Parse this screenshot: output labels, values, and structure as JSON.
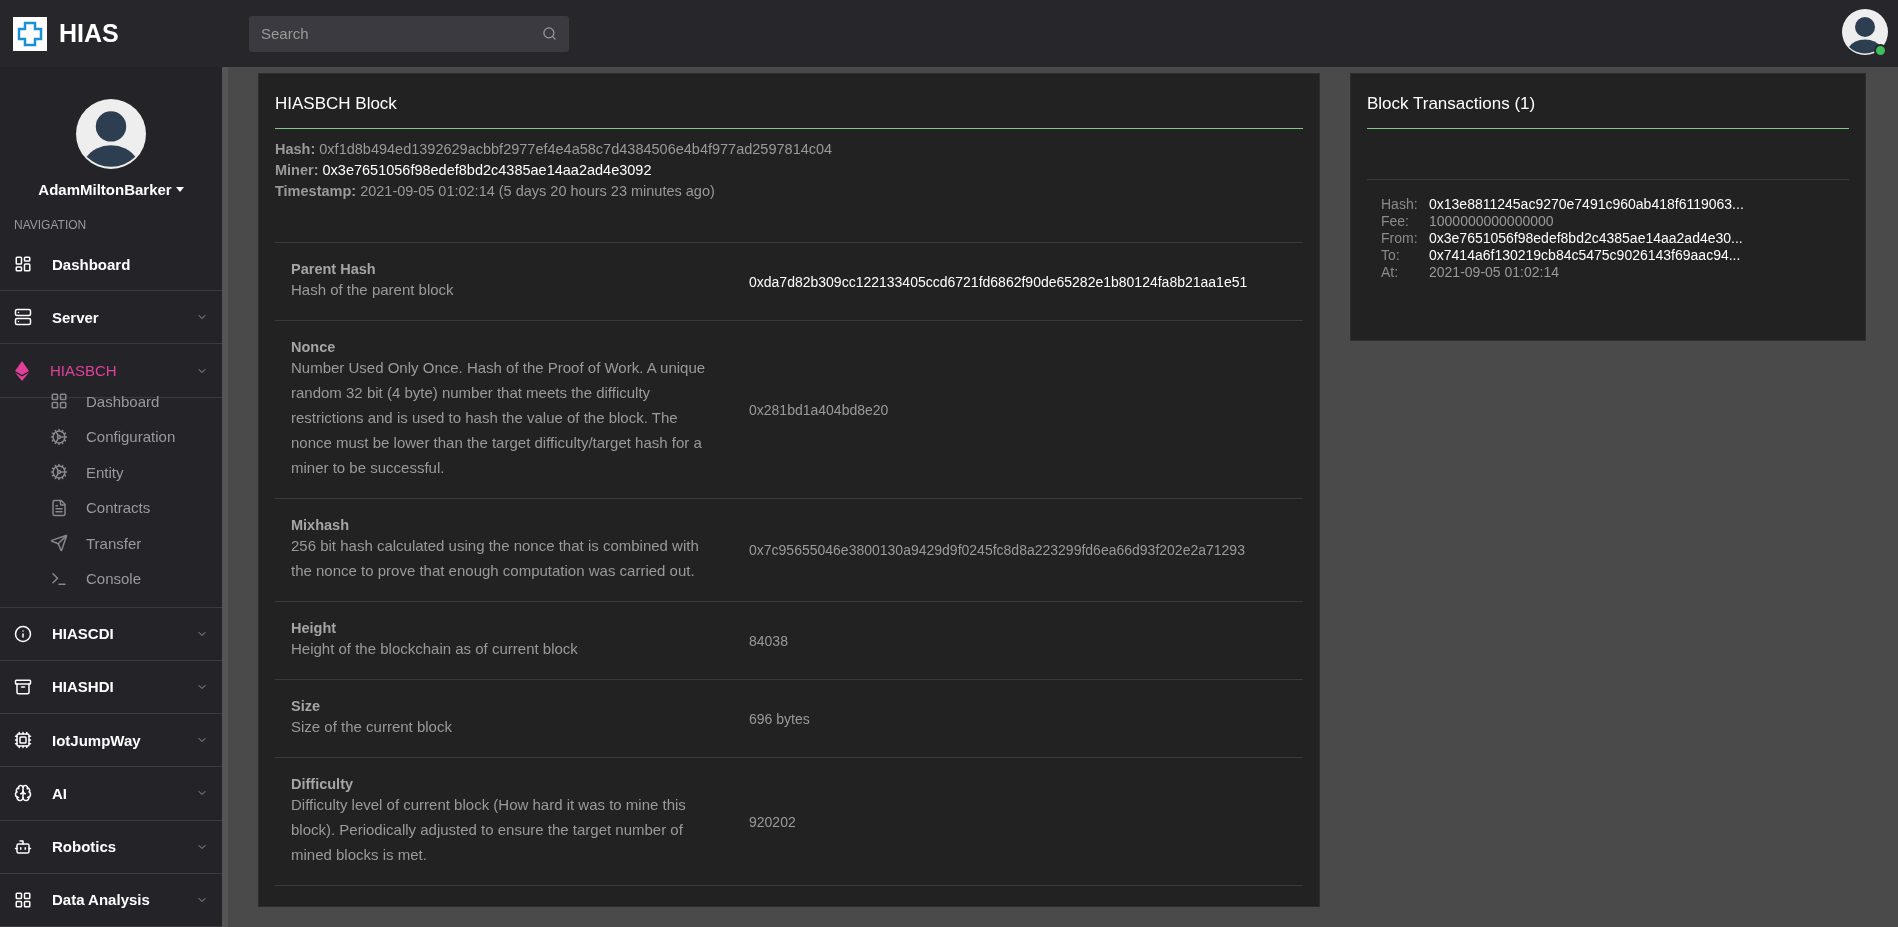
{
  "header": {
    "brand": "HIAS",
    "search": {
      "placeholder": "Search"
    }
  },
  "sidebar": {
    "user": "AdamMiltonBarker",
    "section": "NAVIGATION",
    "items": [
      {
        "label": "Dashboard",
        "selected": false,
        "submenu": false
      },
      {
        "label": "Server",
        "selected": false,
        "submenu": true
      },
      {
        "label": "HIASBCH",
        "selected": true,
        "submenu": true,
        "children": [
          {
            "label": "Dashboard"
          },
          {
            "label": "Configuration"
          },
          {
            "label": "Entity"
          },
          {
            "label": "Contracts"
          },
          {
            "label": "Transfer"
          },
          {
            "label": "Console"
          }
        ]
      },
      {
        "label": "HIASCDI",
        "selected": false,
        "submenu": true
      },
      {
        "label": "HIASHDI",
        "selected": false,
        "submenu": true
      },
      {
        "label": "IotJumpWay",
        "selected": false,
        "submenu": true
      },
      {
        "label": "AI",
        "selected": false,
        "submenu": true
      },
      {
        "label": "Robotics",
        "selected": false,
        "submenu": true
      },
      {
        "label": "Data Analysis",
        "selected": false,
        "submenu": true
      }
    ]
  },
  "block": {
    "title": "HIASBCH Block",
    "meta": [
      {
        "label": "Hash:",
        "value": "0xf1d8b494ed1392629acbbf2977ef4e4a58c7d4384506e4b4f977ad2597814c04",
        "highlight": false
      },
      {
        "label": "Miner:",
        "value": "0x3e7651056f98edef8bd2c4385ae14aa2ad4e3092",
        "highlight": true
      },
      {
        "label": "Timestamp:",
        "value": "2021-09-05 01:02:14 (5 days 20 hours 23 minutes ago)",
        "highlight": false
      }
    ],
    "rows": [
      {
        "label": "Parent Hash",
        "description": "Hash of the parent block",
        "value": "0xda7d82b309cc122133405ccd6721fd6862f90de65282e1b80124fa8b21aa1e51",
        "highlight": true
      },
      {
        "label": "Nonce",
        "description": "Number Used Only Once. Hash of the Proof of Work. A unique random 32 bit (4 byte) number that meets the difficulty restrictions and is used to hash the value of the block. The nonce must be lower than the target difficulty/target hash for a miner to be successful.",
        "value": "0x281bd1a404bd8e20",
        "highlight": false
      },
      {
        "label": "Mixhash",
        "description": "256 bit hash calculated using the nonce that is combined with the nonce to prove that enough computation was carried out.",
        "value": "0x7c95655046e3800130a9429d9f0245fc8d8a223299fd6ea66d93f202e2a71293",
        "highlight": false
      },
      {
        "label": "Height",
        "description": "Height of the blockchain as of current block",
        "value": "84038",
        "highlight": false
      },
      {
        "label": "Size",
        "description": "Size of the current block",
        "value": "696 bytes",
        "highlight": false
      },
      {
        "label": "Difficulty",
        "description": "Difficulty level of current block (How hard it was to mine this block). Periodically adjusted to ensure the target number of mined blocks is met.",
        "value": "920202",
        "highlight": false
      }
    ]
  },
  "transactions": {
    "title": "Block Transactions (1)",
    "fields": [
      {
        "label": "Hash:",
        "value": "0x13e8811245ac9270e7491c960ab418f6119063...",
        "highlight": true
      },
      {
        "label": "Fee:",
        "value": "1000000000000000",
        "highlight": false
      },
      {
        "label": "From:",
        "value": "0x3e7651056f98edef8bd2c4385ae14aa2ad4e30...",
        "highlight": true
      },
      {
        "label": "To:",
        "value": "0x7414a6f130219cb84c5475c9026143f69aac94...",
        "highlight": true
      },
      {
        "label": "At:",
        "value": "2021-09-05 01:02:14",
        "highlight": false
      }
    ]
  }
}
